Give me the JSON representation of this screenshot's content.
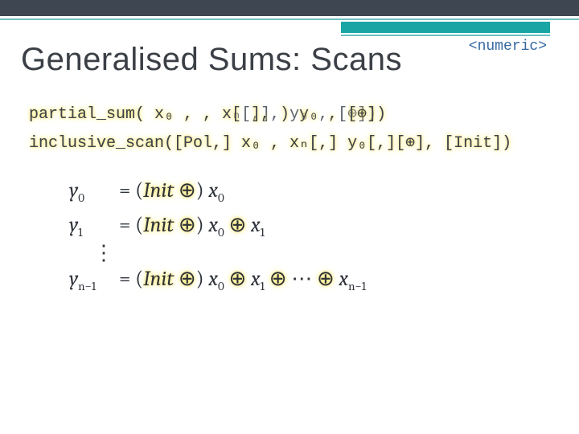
{
  "header_tag": "<numeric>",
  "title": "Generalised Sums: Scans",
  "sig1_highlight": "partial_sum( x₀ , , x[ ], ) y₀ , [⊕])",
  "sig1_plain": "partial_sum( x₀ , , xₙ[,], y₀ , [⊕])",
  "sig2_highlight": "inclusive_scan([Pol,] x₀ , xₙ[,] y₀[,][⊕], [Init])",
  "sig2_plain": "inclusive_scan([Pol,] x₀ , xₙ[,] y₀[,][⊕], [Init])",
  "eq0_html": "<span class='y0'>y<sub>0</sub></span><span class='op'>= </span><span class='paren'>(</span><span class='glow'>Init <span class=\"op\">⊕</span></span><span class='paren'>) </span>x<sub>0</sub>",
  "eq1_html": "<span class='y0'>y<sub>1</sub></span><span class='op'>= </span><span class='paren'>(</span><span class='glow'>Init <span class=\"op\">⊕</span></span><span class='paren'>) </span>x<sub>0</sub> <span class='glow op'>⊕</span> x<sub>1</sub>",
  "eqN_html": "<span class='y0'>y<sub>n−1</sub></span><span class='op'>= </span><span class='paren'>(</span><span class='glow'>Init <span class=\"op\">⊕</span></span><span class='paren'>) </span>x<sub>0</sub> <span class='glow op'>⊕</span> x<sub>1</sub> <span class='glow op'>⊕</span> <span class='op'>⋯</span> <span class='glow op'>⊕</span> x<sub>n−1</sub>",
  "vdots": "⋮"
}
